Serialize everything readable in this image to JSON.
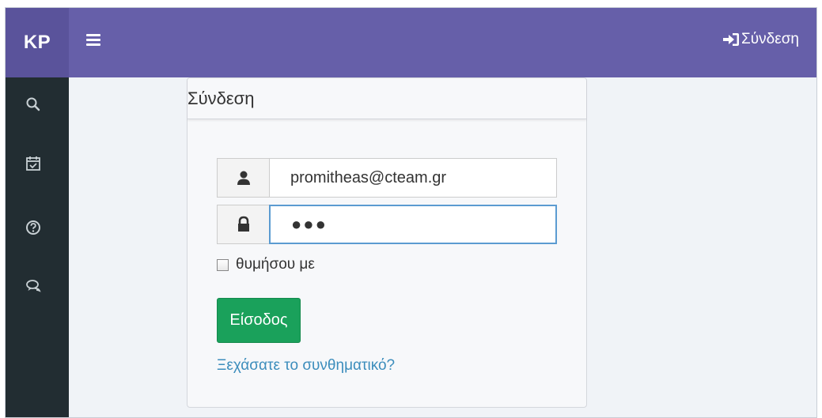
{
  "header": {
    "brand": "KP",
    "menu_icon": "hamburger-icon",
    "login_label": "Σύνδεση",
    "login_icon": "sign-in-icon"
  },
  "sidebar": {
    "items": [
      {
        "icon": "search-icon"
      },
      {
        "icon": "calendar-check-icon"
      },
      {
        "icon": "help-circle-icon"
      },
      {
        "icon": "chat-bubbles-icon"
      }
    ]
  },
  "login_panel": {
    "title": "Σύνδεση",
    "username_value": "promitheas@cteam.gr",
    "username_icon": "user-icon",
    "password_mask": "●●●",
    "password_icon": "lock-icon",
    "remember_label": "θυμήσου με",
    "submit_label": "Είσοδος",
    "forgot_link": "Ξεχάσατε το συνθηματικό?"
  },
  "colors": {
    "header_bg": "#665fa9",
    "brand_bg": "#5a539b",
    "sidebar_bg": "#222d32",
    "content_bg": "#f0f3f7",
    "button_bg": "#1aa15b",
    "link": "#3c8dbc",
    "focus_border": "#5b9bd1"
  }
}
